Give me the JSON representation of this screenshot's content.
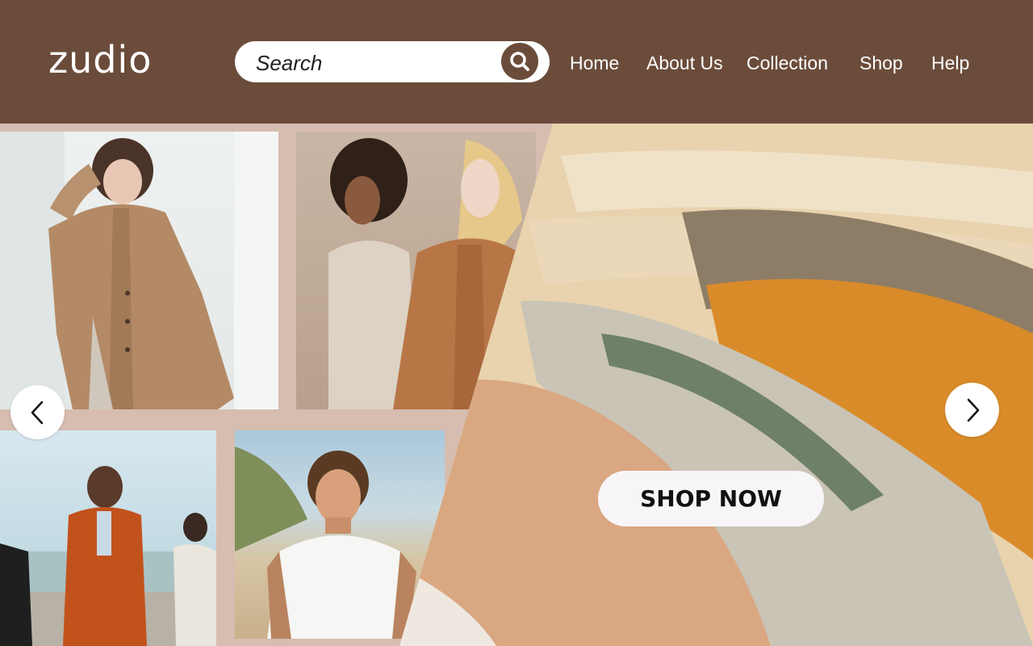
{
  "brand": {
    "name": "zudio"
  },
  "search": {
    "placeholder": "Search",
    "icon": "search-icon"
  },
  "nav": {
    "items": [
      "Home",
      "About Us",
      "Collection",
      "Shop",
      "Help"
    ]
  },
  "hero": {
    "cta_label": "SHOP NOW",
    "prev_icon": "chevron-left-icon",
    "next_icon": "chevron-right-icon"
  },
  "colors": {
    "header_bg": "#6b4c3b",
    "collage_bg": "#d8bfb2",
    "text_on_header": "#ffffff",
    "cta_bg": "#f7f5f8"
  }
}
